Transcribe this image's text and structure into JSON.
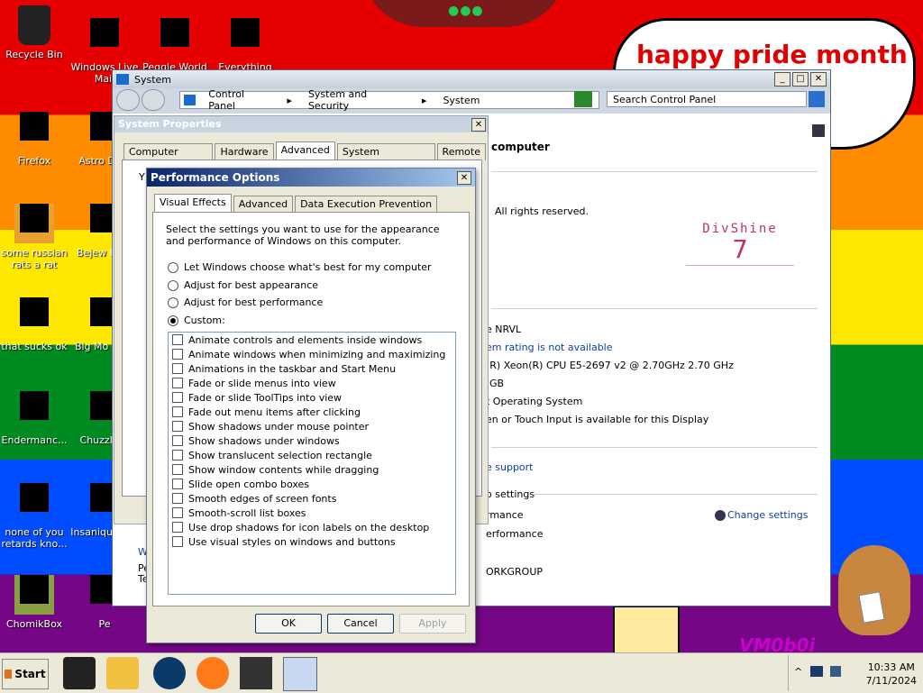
{
  "desktop": {
    "speech_bubble": "happy pride month",
    "graffiti": "VM0b0i",
    "icons": [
      {
        "label": "Recycle Bin"
      },
      {
        "label": "Windows Live Mail"
      },
      {
        "label": "Peggle World"
      },
      {
        "label": "Everything"
      },
      {
        "label": "Firefox"
      },
      {
        "label": "Astro Delu"
      },
      {
        "label": "some russian rats a rat"
      },
      {
        "label": "Bejew Delu"
      },
      {
        "label": "that sucks ok"
      },
      {
        "label": "Big Mo Delu"
      },
      {
        "label": "Endermanc..."
      },
      {
        "label": "Chuzzle D"
      },
      {
        "label": "none of you retards kno..."
      },
      {
        "label": "Insaniqu Delu"
      },
      {
        "label": "ChomikBox"
      },
      {
        "label": "Pe"
      }
    ]
  },
  "system_window": {
    "title": "System",
    "breadcrumb": [
      "Control Panel",
      "System and Security",
      "System"
    ],
    "search_placeholder": "Search Control Panel",
    "heading": "computer",
    "copyright": "All rights reserved.",
    "logo_line1": "DivShine",
    "logo_line2": "7",
    "rows": [
      {
        "text": "e NRVL",
        "link": false
      },
      {
        "text": "em rating is not available",
        "link": true
      },
      {
        "text": "(R) Xeon(R) CPU E5-2697 v2 @ 2.70GHz   2.70 GHz",
        "link": false
      },
      {
        "text": "GB",
        "link": false
      },
      {
        "text": "t Operating System",
        "link": false
      },
      {
        "text": "en or Touch Input is available for this Display",
        "link": false
      },
      {
        "text": "e support",
        "link": true
      },
      {
        "text": "o settings",
        "link": false
      },
      {
        "text": "rmance",
        "link": false
      },
      {
        "text": "erformance",
        "link": false
      },
      {
        "text": "ORKGROUP",
        "link": false
      }
    ],
    "change_settings": "Change settings",
    "left_fragments": [
      "W",
      "Pe",
      "Te"
    ]
  },
  "system_properties": {
    "title": "System Properties",
    "tabs": [
      "Computer Name",
      "Hardware",
      "Advanced",
      "System Protection",
      "Remote"
    ],
    "active_tab": "Advanced",
    "partial_text": "Y"
  },
  "performance_options": {
    "title": "Performance Options",
    "tabs": [
      "Visual Effects",
      "Advanced",
      "Data Execution Prevention"
    ],
    "description": "Select the settings you want to use for the appearance and performance of Windows on this computer.",
    "radios": [
      {
        "label": "Let Windows choose what's best for my computer",
        "selected": false
      },
      {
        "label": "Adjust for best appearance",
        "selected": false
      },
      {
        "label": "Adjust for best performance",
        "selected": false
      },
      {
        "label": "Custom:",
        "selected": true
      }
    ],
    "checkboxes": [
      {
        "label": "Animate controls and elements inside windows",
        "checked": false
      },
      {
        "label": "Animate windows when minimizing and maximizing",
        "checked": false
      },
      {
        "label": "Animations in the taskbar and Start Menu",
        "checked": false
      },
      {
        "label": "Fade or slide menus into view",
        "checked": false
      },
      {
        "label": "Fade or slide ToolTips into view",
        "checked": false
      },
      {
        "label": "Fade out menu items after clicking",
        "checked": false
      },
      {
        "label": "Show shadows under mouse pointer",
        "checked": false
      },
      {
        "label": "Show shadows under windows",
        "checked": false
      },
      {
        "label": "Show translucent selection rectangle",
        "checked": false
      },
      {
        "label": "Show window contents while dragging",
        "checked": false
      },
      {
        "label": "Slide open combo boxes",
        "checked": false
      },
      {
        "label": "Smooth edges of screen fonts",
        "checked": false
      },
      {
        "label": "Smooth-scroll list boxes",
        "checked": false
      },
      {
        "label": "Use drop shadows for icon labels on the desktop",
        "checked": false
      },
      {
        "label": "Use visual styles on windows and buttons",
        "checked": false
      }
    ],
    "ok": "OK",
    "cancel": "Cancel",
    "apply": "Apply"
  },
  "taskbar": {
    "start": "Start",
    "time": "10:33 AM",
    "date": "7/11/2024"
  }
}
